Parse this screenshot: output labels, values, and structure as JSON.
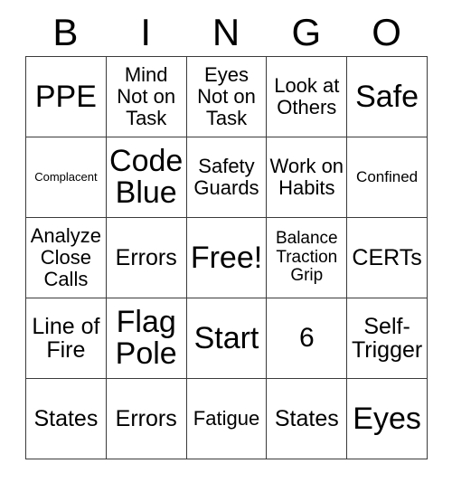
{
  "card": {
    "title": "BINGO",
    "headers": [
      "B",
      "I",
      "N",
      "G",
      "O"
    ],
    "free_space_label": "Free!",
    "border_color": "#3b3b3b",
    "background_color": "#ffffff",
    "text_color": "#000000",
    "rows": 5,
    "columns": 5,
    "cells": [
      [
        {
          "text": "PPE",
          "size": "xxl"
        },
        {
          "text": "Mind Not on Task",
          "size": "m"
        },
        {
          "text": "Eyes Not on Task",
          "size": "m"
        },
        {
          "text": "Look at Others",
          "size": "m"
        },
        {
          "text": "Safe",
          "size": "xxl"
        }
      ],
      [
        {
          "text": "Complacent",
          "size": "xxs"
        },
        {
          "text": "Code Blue",
          "size": "xxl"
        },
        {
          "text": "Safety Guards",
          "size": "m"
        },
        {
          "text": "Work on Habits",
          "size": "m"
        },
        {
          "text": "Confined",
          "size": "xs"
        }
      ],
      [
        {
          "text": "Analyze Close Calls",
          "size": "m"
        },
        {
          "text": "Errors",
          "size": "l"
        },
        {
          "text": "Free!",
          "size": "xxl"
        },
        {
          "text": "Balance Traction Grip",
          "size": "s"
        },
        {
          "text": "CERTs",
          "size": "l"
        }
      ],
      [
        {
          "text": "Line of Fire",
          "size": "l"
        },
        {
          "text": "Flag Pole",
          "size": "xxl"
        },
        {
          "text": "Start",
          "size": "xxl"
        },
        {
          "text": "6",
          "size": "xl"
        },
        {
          "text": "Self-Trigger",
          "size": "l"
        }
      ],
      [
        {
          "text": "States",
          "size": "l"
        },
        {
          "text": "Errors",
          "size": "l"
        },
        {
          "text": "Fatigue",
          "size": "m"
        },
        {
          "text": "States",
          "size": "l"
        },
        {
          "text": "Eyes",
          "size": "xxl"
        }
      ]
    ]
  }
}
